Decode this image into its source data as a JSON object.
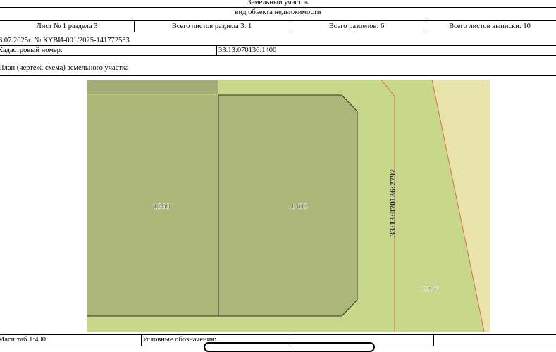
{
  "header": {
    "object_type": "Земельный участок",
    "object_kind_label": "вид объекта недвижимости"
  },
  "sheet_info": {
    "sheet_label": "Лист № 1 раздела 3",
    "total_sheets_section_label": "Всего листов раздела 3: 1",
    "total_sections_label": "Всего разделов: 6",
    "total_sheets_extract_label": "Всего листов выписки: 10"
  },
  "document_ref": "8.07.2025г. № КУВИ-001/2025-141772533",
  "cadastral": {
    "label": "Кадастровый номер:",
    "value": "33:13:070136:1400"
  },
  "plan_title": "План (чертеж, схема) земельного участка",
  "map": {
    "parcel_labels": {
      "left": ":1399",
      "main": ":1400",
      "road": "33:13:070136:2792",
      "right": ":1279"
    },
    "colors": {
      "parcel_fill": "#adb77a",
      "background_green": "#c8d88a",
      "beige": "#e8e4ac",
      "boundary_red": "#e06a50",
      "outline": "#333333"
    }
  },
  "footer": {
    "scale_label": "Масштаб 1:400",
    "legend_label": "Условные обозначения:"
  }
}
